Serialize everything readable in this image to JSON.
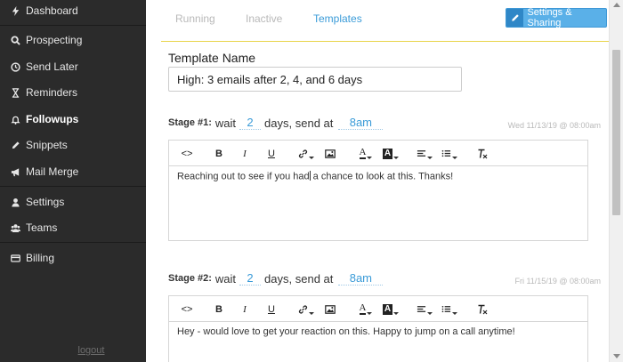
{
  "sidebar": {
    "items": [
      {
        "label": "Dashboard",
        "icon": "bolt-icon"
      },
      {
        "label": "Prospecting",
        "icon": "search-icon"
      },
      {
        "label": "Send Later",
        "icon": "clock-icon"
      },
      {
        "label": "Reminders",
        "icon": "hourglass-icon"
      },
      {
        "label": "Followups",
        "icon": "bell-icon"
      },
      {
        "label": "Snippets",
        "icon": "pencil-icon"
      },
      {
        "label": "Mail Merge",
        "icon": "bullhorn-icon"
      },
      {
        "label": "Settings",
        "icon": "user-icon"
      },
      {
        "label": "Teams",
        "icon": "users-icon"
      },
      {
        "label": "Billing",
        "icon": "credit-card-icon"
      }
    ],
    "active": "Followups",
    "logout": "logout"
  },
  "tabs": {
    "running": "Running",
    "inactive": "Inactive",
    "templates": "Templates",
    "active": "Templates"
  },
  "settings_button": "Settings & Sharing",
  "template": {
    "name_label": "Template Name",
    "name_value": "High: 3 emails after 2, 4, and 6 days"
  },
  "toolbar": {
    "source": "<>",
    "bold": "B",
    "italic": "I",
    "underline": "U",
    "link": "link-icon",
    "image": "image-icon",
    "text_color": "A",
    "bg_color": "A",
    "align": "align-icon",
    "list": "list-icon",
    "clear": "clear-format-icon"
  },
  "stages": [
    {
      "label": "Stage #1:",
      "wait": "wait",
      "days": "2",
      "days_text": "days, send at",
      "time": "8am",
      "date": "Wed 11/13/19 @ 08:00am",
      "body_before": "Reaching out to see if you had",
      "body_after": " a chance to look at this. Thanks!"
    },
    {
      "label": "Stage #2:",
      "wait": "wait",
      "days": "2",
      "days_text": "days, send at",
      "time": "8am",
      "date": "Fri 11/15/19 @ 08:00am",
      "body_before": "Hey - would love to get your reaction on this. Happy to jump on a call anytime!",
      "body_after": ""
    }
  ],
  "colors": {
    "sidebar_bg": "#2b2b2b",
    "accent": "#3a9bd8",
    "button_bg": "#5ab0e8",
    "divider_yellow": "#e8d44a"
  }
}
